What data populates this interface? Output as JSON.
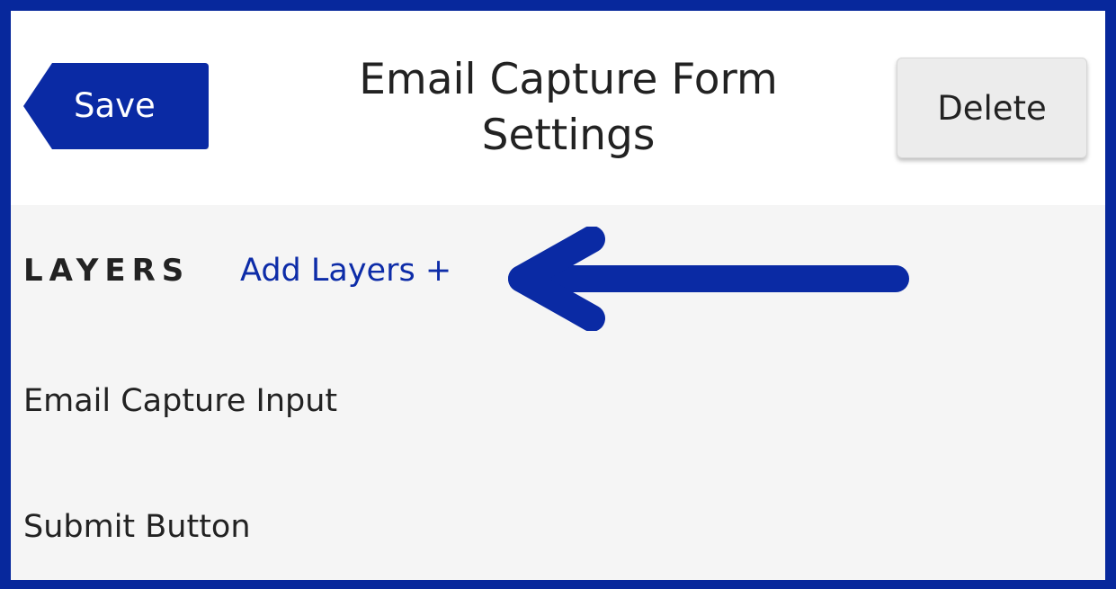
{
  "header": {
    "save_label": "Save",
    "title": "Email Capture Form Settings",
    "delete_label": "Delete"
  },
  "layers": {
    "section_label": "LAYERS",
    "add_label": "Add Layers +",
    "items": [
      {
        "label": "Email Capture Input"
      },
      {
        "label": "Submit Button"
      }
    ]
  },
  "annotation": {
    "arrow_icon": "left-arrow-icon",
    "arrow_color": "#0a2aa4"
  },
  "colors": {
    "accent": "#0a2aa4",
    "frame_border": "#07289c",
    "content_background": "#f5f5f5"
  }
}
